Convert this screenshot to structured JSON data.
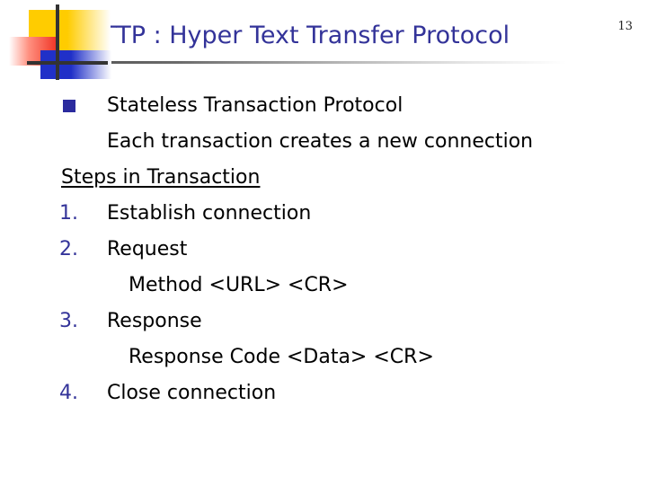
{
  "page": {
    "number": "13"
  },
  "header": {
    "title": "HTTP : Hyper Text Transfer Protocol",
    "title_color": "#333399",
    "rule_color": "#4a4a4a",
    "decoration": {
      "yellow": "#FFCC00",
      "red": "#F03020",
      "blue": "#2030C8",
      "line": "#333333"
    }
  },
  "body": {
    "lines": [
      {
        "marker_type": "square",
        "marker": "n",
        "indent": "ind-1",
        "text": "Stateless Transaction Protocol",
        "style": "plain"
      },
      {
        "marker_type": "none",
        "marker": "",
        "indent": "ind-2",
        "text": "Each transaction creates a new connection",
        "style": "plain"
      },
      {
        "marker_type": "none",
        "marker": "",
        "indent": "ind-head",
        "text": "Steps in Transaction",
        "style": "underline"
      },
      {
        "marker_type": "num",
        "marker": "1.",
        "indent": "ind-1",
        "text": "Establish connection",
        "style": "plain"
      },
      {
        "marker_type": "num",
        "marker": "2.",
        "indent": "ind-1",
        "text": "Request",
        "style": "plain"
      },
      {
        "marker_type": "none",
        "marker": "",
        "indent": "ind-sub",
        "text": "Method <URL> <CR>",
        "style": "plain"
      },
      {
        "marker_type": "num",
        "marker": "3.",
        "indent": "ind-1",
        "text": "Response",
        "style": "plain"
      },
      {
        "marker_type": "none",
        "marker": "",
        "indent": "ind-sub",
        "text": "Response Code <Data> <CR>",
        "style": "plain"
      },
      {
        "marker_type": "num",
        "marker": "4.",
        "indent": "ind-1",
        "text": "Close connection",
        "style": "plain"
      }
    ]
  }
}
